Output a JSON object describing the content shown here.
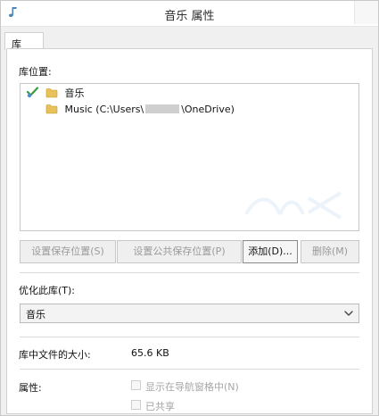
{
  "window": {
    "title": "音乐 属性"
  },
  "tabs": [
    {
      "label": "库"
    }
  ],
  "library_locations": {
    "label": "库位置:",
    "items": [
      {
        "name": "音乐",
        "is_default": true
      },
      {
        "name_prefix": "Music (C:\\Users\\",
        "name_suffix": "\\OneDrive)"
      }
    ]
  },
  "buttons": {
    "set_save_location": "设置保存位置(S)",
    "set_public_save_location": "设置公共保存位置(P)",
    "add": "添加(D)...",
    "remove": "删除(M)"
  },
  "optimize": {
    "label": "优化此库(T):",
    "selected": "音乐"
  },
  "size": {
    "label": "库中文件的大小:",
    "value": "65.6 KB"
  },
  "attributes": {
    "label": "属性:",
    "options": [
      {
        "label": "显示在导航窗格中(N)",
        "checked": false,
        "enabled": false
      },
      {
        "label": "已共享",
        "checked": false,
        "enabled": false
      }
    ]
  },
  "colors": {
    "window_bg": "#f0f0f0",
    "panel_bg": "#ffffff",
    "border": "#c8c8c8",
    "disabled_text": "#9a9a9a",
    "folder_yellow": "#e7c15a"
  },
  "icons": {
    "title": "music-library-icon",
    "default_marker": "default-save-location-check-icon",
    "folder": "folder-icon",
    "dropdown": "chevron-down-icon"
  }
}
